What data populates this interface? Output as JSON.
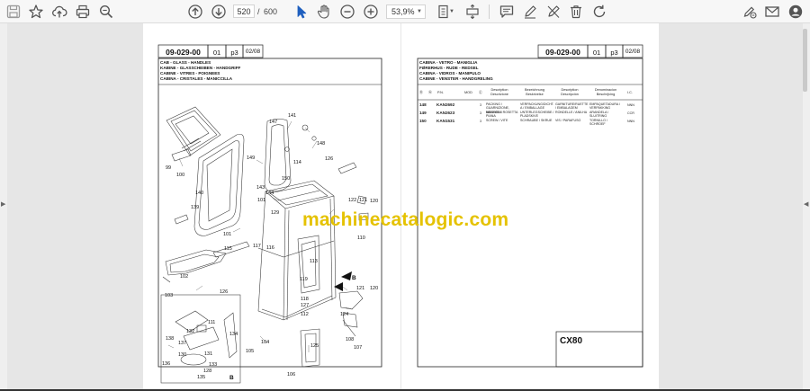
{
  "toolbar": {
    "page_current": "520",
    "page_separator": "/",
    "page_total": "600",
    "zoom": "53,9%"
  },
  "left_page": {
    "code": "09-029-00",
    "rev": "01",
    "pg": "p3",
    "date": "02/08",
    "captions": [
      "CAB - GLASS - HANDLES",
      "KABINE - GLASSCHEIBEN - HANDGRIFF",
      "CABINE - VITRES - POIGNEES",
      "CABINA - CRISTALES - MANICCILLA"
    ],
    "callouts": [
      "141",
      "147",
      "114",
      "148",
      "126",
      "149",
      "99",
      "100",
      "140",
      "150",
      "143",
      "144",
      "101",
      "129",
      "139",
      "122",
      "121",
      "120",
      "110",
      "101",
      "115",
      "117",
      "116",
      "113",
      "102",
      "119",
      "103",
      "126",
      "120",
      "118",
      "127",
      "121",
      "112",
      "111",
      "124",
      "138",
      "137",
      "132",
      "131",
      "134",
      "130",
      "104",
      "125",
      "107",
      "105",
      "108",
      "136",
      "133",
      "128",
      "135",
      "106",
      "B",
      "B"
    ]
  },
  "right_page": {
    "code": "09-029-00",
    "rev": "01",
    "pg": "p3",
    "date": "02/08",
    "captions": [
      "CABINA - VETRO - MANIGLIA",
      "FØRERHUS - RUDE - REDSEL",
      "CABINA - VIDROS - MANIPULO",
      "CABINE - VENSTER - HANDGRELING"
    ],
    "table_headers": [
      "Ⓡ",
      "Ⓝ",
      "P.N.",
      "MOD",
      "Ⓒ",
      "Description Descrizione",
      "Bezeichnung Beskrivelse",
      "Description Descripción",
      "Denominacion Beschrijving",
      "I.C."
    ],
    "rows": [
      {
        "ref": "148",
        "pn": "KAN2692",
        "qty": "3",
        "desc1": "PACKING / GUARNIZIONE, MENSOLA",
        "desc2": "VERPACKUNG/DICHT. A / EMBALLAGE",
        "desc3": "GARNITURE/RUETTE / EMBALAGEM",
        "desc4": "EMPAQUETADURA / VERPAKKING",
        "ic": "NNN"
      },
      {
        "ref": "149",
        "pn": "KAN2623",
        "qty": "3",
        "desc1": "WASHER / ROSETTA PIANA",
        "desc2": "UNTERLEGSCHEIBE / PLADSKIVE",
        "desc3": "RONDELLE / ANILHA",
        "desc4": "ARANDELA / SLUITRING",
        "ic": "CCR"
      },
      {
        "ref": "150",
        "pn": "KAN1531",
        "qty": "3",
        "desc1": "SCREW / VITE",
        "desc2": "SCHRAUBE / SKRUE",
        "desc3": "VIS / PARAFUSO",
        "desc4": "TORNILLO / SCHROEF",
        "ic": "NNN"
      }
    ],
    "model": "CX80"
  },
  "watermark": "machinecatalogic.com"
}
